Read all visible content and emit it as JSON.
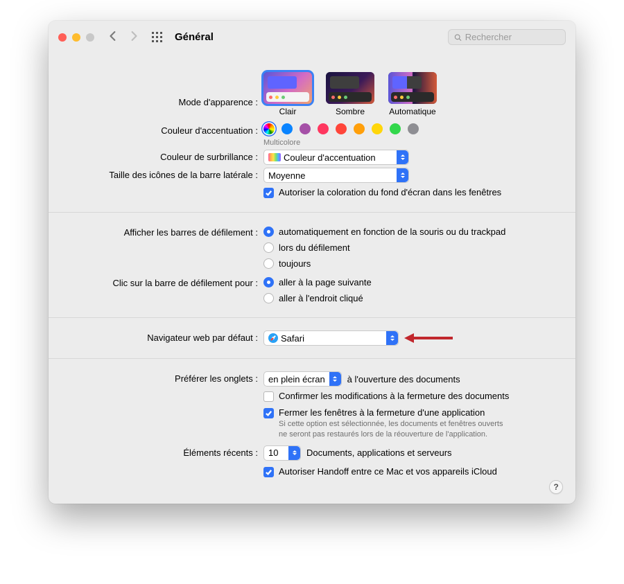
{
  "toolbar": {
    "title": "Général",
    "search_placeholder": "Rechercher"
  },
  "appearance": {
    "label": "Mode d'apparence :",
    "options": {
      "light": "Clair",
      "dark": "Sombre",
      "auto": "Automatique"
    }
  },
  "accent": {
    "label": "Couleur d'accentuation :",
    "sub": "Multicolore",
    "colors": [
      "#0a84ff",
      "#a550a7",
      "#ff375f",
      "#ff453a",
      "#ff9f0a",
      "#ffd60a",
      "#32d74b",
      "#8e8e93"
    ]
  },
  "highlight": {
    "label": "Couleur de surbrillance :",
    "value": "Couleur d'accentuation"
  },
  "sidebar_size": {
    "label": "Taille des icônes de la barre latérale :",
    "value": "Moyenne"
  },
  "wallpaper_tint": {
    "label": "Autoriser la coloration du fond d'écran dans les fenêtres"
  },
  "scrollbars": {
    "label": "Afficher les barres de défilement :",
    "opts": {
      "auto": "automatiquement en fonction de la souris ou du trackpad",
      "scroll": "lors du défilement",
      "always": "toujours"
    }
  },
  "scrollclick": {
    "label": "Clic sur la barre de défilement pour :",
    "opts": {
      "next": "aller à la page suivante",
      "spot": "aller à l'endroit cliqué"
    }
  },
  "browser": {
    "label": "Navigateur web par défaut :",
    "value": "Safari"
  },
  "tabs": {
    "label": "Préférer les onglets :",
    "mode": "en plein écran",
    "suffix": "à l'ouverture des documents"
  },
  "confirm_close": {
    "label": "Confirmer les modifications à la fermeture des documents"
  },
  "close_windows": {
    "label": "Fermer les fenêtres à la fermeture d'une application",
    "desc": "Si cette option est sélectionnée, les documents et fenêtres ouverts ne seront pas restaurés lors de la réouverture de l'application."
  },
  "recent": {
    "label": "Éléments récents :",
    "value": "10",
    "suffix": "Documents, applications et serveurs"
  },
  "handoff": {
    "label": "Autoriser Handoff entre ce Mac et vos appareils iCloud"
  },
  "help": "?"
}
